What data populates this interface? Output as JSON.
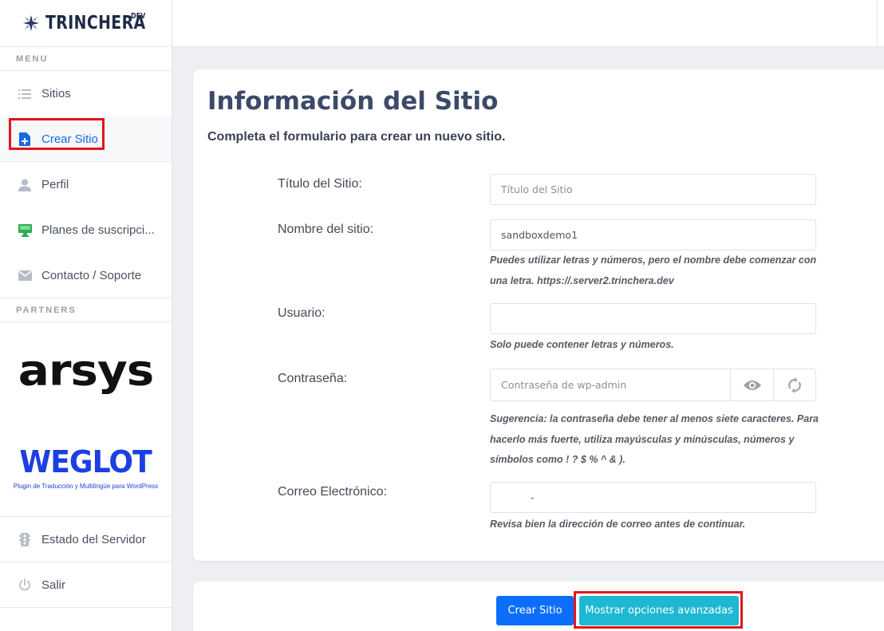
{
  "brand": {
    "name": "TRINCHERA",
    "suffix": "DEV"
  },
  "sidebar": {
    "menu_label": "MENU",
    "items": [
      {
        "label": "Sitios",
        "icon": "list-icon",
        "active": false
      },
      {
        "label": "Crear Sitio",
        "icon": "file-add-icon",
        "active": true
      },
      {
        "label": "Perfil",
        "icon": "user-icon",
        "active": false
      },
      {
        "label": "Planes de suscripci...",
        "icon": "monitor-icon",
        "active": false
      },
      {
        "label": "Contacto / Soporte",
        "icon": "mail-icon",
        "active": false
      }
    ],
    "partners_label": "PARTNERS",
    "partners": {
      "arsys": "arsys",
      "weglot": "WEGLOT",
      "weglot_sub": "Plugin de Traducción y Multilingüe para WordPress"
    },
    "bottom_items": [
      {
        "label": "Estado del Servidor",
        "icon": "traffic-light-icon"
      },
      {
        "label": "Salir",
        "icon": "power-icon"
      }
    ]
  },
  "main": {
    "title": "Información del Sitio",
    "subtitle": "Completa el formulario para crear un nuevo sitio.",
    "fields": {
      "site_title": {
        "label": "Título del Sitio:",
        "placeholder": "Título del Sitio",
        "value": ""
      },
      "site_name": {
        "label": "Nombre del sitio:",
        "value": "sandboxdemo1",
        "help": "Puedes utilizar letras y números, pero el nombre debe comenzar con una letra. https://.server2.trinchera.dev"
      },
      "user": {
        "label": "Usuario:",
        "value": "",
        "help": "Solo puede contener letras y números."
      },
      "password": {
        "label": "Contraseña:",
        "placeholder": "Contraseña de wp-admin",
        "help": "Sugerencia: la contraseña debe tener al menos siete caracteres. Para hacerlo más fuerte, utiliza mayúsculas y minúsculas, números y símbolos como ! ? $ % ^ & )."
      },
      "email": {
        "label": "Correo Electrónico:",
        "value": "-",
        "help": "Revisa bien la dirección de correo antes de continuar."
      }
    },
    "buttons": {
      "create": "Crear Sitio",
      "advanced": "Mostrar opciones avanzadas"
    }
  },
  "colors": {
    "accent": "#1769e0",
    "primary": "#0d6efd",
    "info": "#1fb8d3",
    "highlight": "#e0161f"
  }
}
